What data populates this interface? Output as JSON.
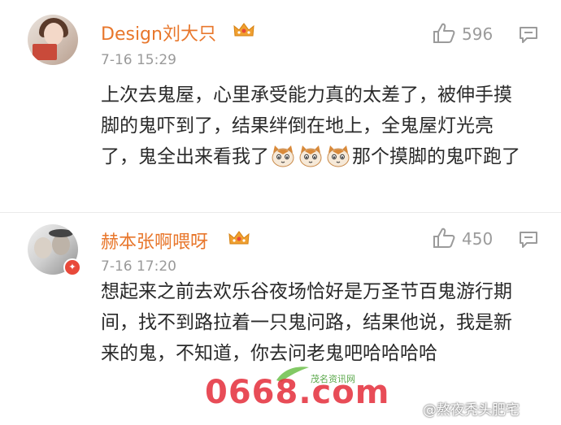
{
  "comments": [
    {
      "username": "Design刘大只",
      "time": "7-16 15:29",
      "likes": "596",
      "text_before": "上次去鬼屋，心里承受能力真的太差了，被伸手摸脚的鬼吓到了，结果绊倒在地上，全鬼屋灯光亮了，鬼全出来看我了",
      "text_after": "那个摸脚的鬼吓跑了",
      "emoji_name": "cat-face-emoji",
      "emoji_count": 3
    },
    {
      "username": "赫本张啊喂呀",
      "time": "7-16 17:20",
      "likes": "450",
      "text": "想起来之前去欢乐谷夜场恰好是万圣节百鬼游行期间，找不到路拉着一只鬼问路，结果他说，我是新来的鬼，不知道，你去问老鬼吧哈哈哈哈"
    }
  ],
  "watermarks": {
    "site_number": "0668.com",
    "site_name": "茂名资讯网",
    "weibo_handle": "@熬夜秃头肥宅"
  },
  "colors": {
    "username": "#e8772c",
    "meta": "#9a9a9a",
    "body": "#2a2a2a",
    "crown": "#f0a030",
    "watermark_red": "#e52d3a"
  },
  "icons": [
    "thumb-up-icon",
    "reply-icon",
    "crown-icon",
    "vip-badge-icon"
  ]
}
